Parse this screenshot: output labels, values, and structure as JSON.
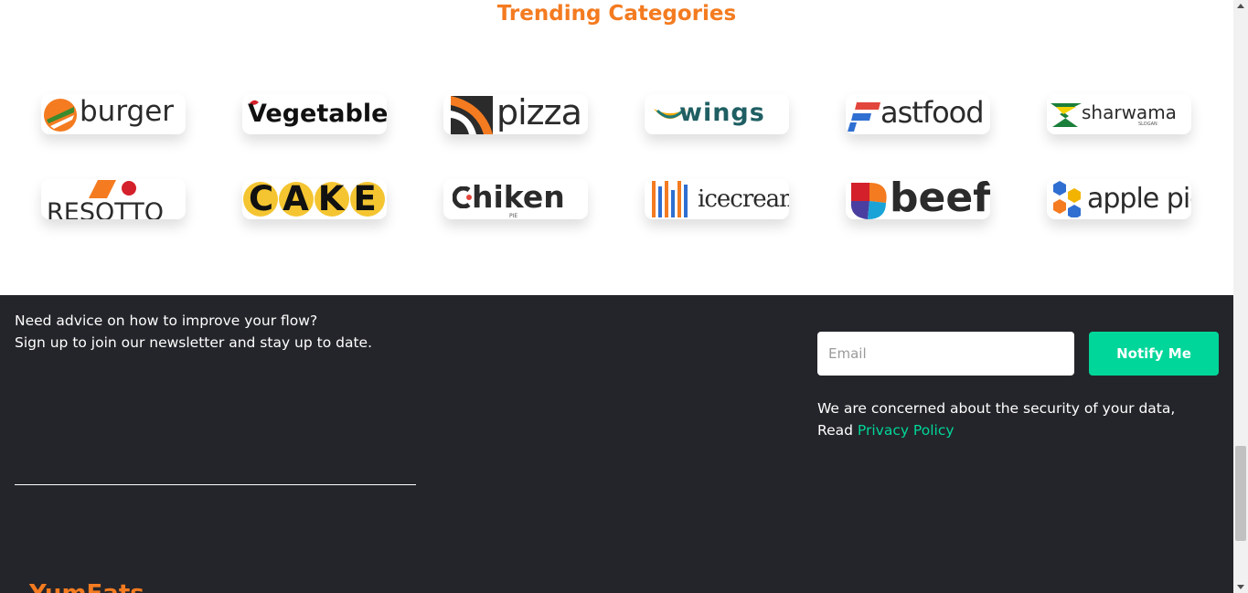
{
  "trending": {
    "title": "Trending Categories",
    "categories": [
      {
        "label": "burger",
        "icon": "burger-logo-icon"
      },
      {
        "label": "Vegetable",
        "icon": "vegetable-logo-icon"
      },
      {
        "label": "pizza",
        "icon": "pizza-logo-icon"
      },
      {
        "label": "wings",
        "icon": "wings-logo-icon"
      },
      {
        "label": "astfood",
        "icon": "fastfood-logo-icon"
      },
      {
        "label": "sharwama",
        "sub": "SLOGAN",
        "icon": "sharwama-logo-icon"
      },
      {
        "label": "RESOTTO",
        "icon": "resotto-logo-icon"
      },
      {
        "label": "CAKE",
        "icon": "cake-logo-icon"
      },
      {
        "label": "hiken",
        "sub": "PIE",
        "icon": "chiken-logo-icon"
      },
      {
        "label": "icecream",
        "icon": "icecream-logo-icon"
      },
      {
        "label": "beef",
        "icon": "beef-logo-icon"
      },
      {
        "label": "apple pie",
        "icon": "apple-pie-logo-icon"
      }
    ]
  },
  "newsletter": {
    "line1": "Need advice on how to improve your flow?",
    "line2": "Sign up to join our newsletter and stay up to date.",
    "email_placeholder": "Email",
    "button_label": "Notify Me",
    "security_text": "We are concerned about the security of your data,",
    "read_label": "Read",
    "privacy_link": "Privacy Policy"
  },
  "brand": {
    "name": "YumEats"
  },
  "colors": {
    "accent": "#f47b20",
    "green": "#00d699",
    "footer_bg": "#24252a"
  }
}
